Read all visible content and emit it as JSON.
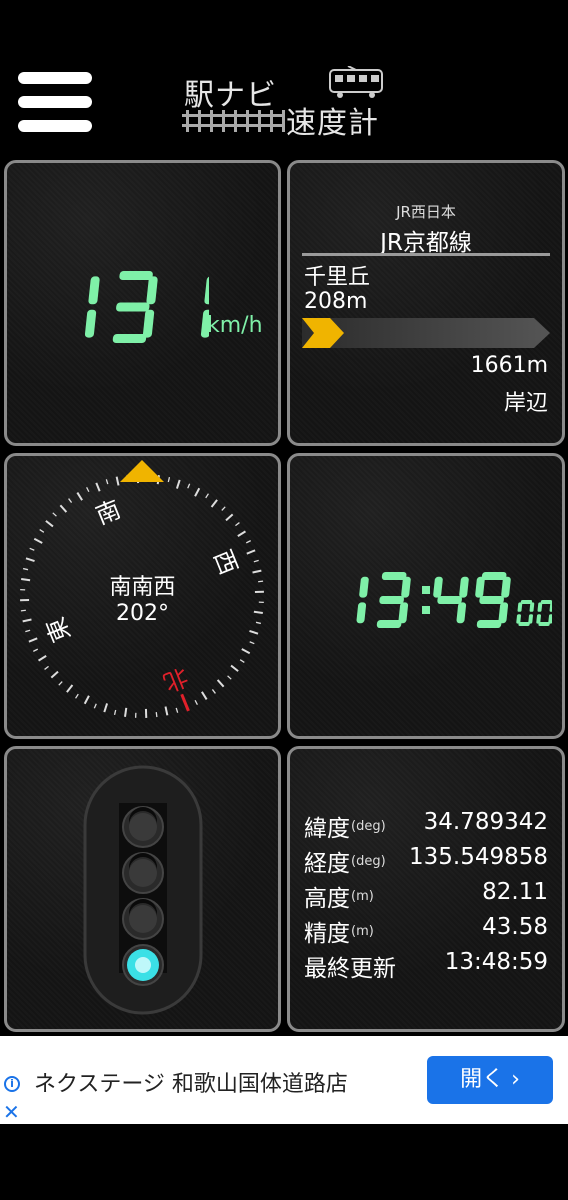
{
  "header": {
    "logo_line1": "駅ナビ",
    "logo_line2": "速度計"
  },
  "speed": {
    "value": "131",
    "unit": "km/h",
    "digit_color": "#7ff0a8"
  },
  "route": {
    "company": "JR西日本",
    "line": "JR京都線",
    "prev_station": "千里丘",
    "prev_distance": "208m",
    "next_distance": "1661m",
    "next_station": "岸辺",
    "progress": 0.112,
    "arrow_color": "#f0b400"
  },
  "compass": {
    "direction": "南南西",
    "degrees": "202°",
    "heading_deg": 202,
    "labels": {
      "north": "北",
      "east": "東",
      "south": "南",
      "west": "西"
    },
    "pointer_color": "#f0b400",
    "north_color": "#e0202a"
  },
  "clock": {
    "hm": "13:49",
    "seconds": "00",
    "digit_color": "#7ff0a8"
  },
  "signal": {
    "active_lamp": 4,
    "lamp_color": "#3be0e6"
  },
  "gps": {
    "rows": [
      {
        "label": "緯度",
        "unit": "(deg)",
        "value": "34.789342"
      },
      {
        "label": "経度",
        "unit": "(deg)",
        "value": "135.549858"
      },
      {
        "label": "高度",
        "unit": "(m)",
        "value": "82.11"
      },
      {
        "label": "精度",
        "unit": "(m)",
        "value": "43.58"
      },
      {
        "label": "最終更新",
        "unit": "",
        "value": "13:48:59"
      }
    ]
  },
  "ad": {
    "text": "ネクステージ 和歌山国体道路店",
    "button": "開く ›",
    "button_color": "#1a73e8"
  }
}
